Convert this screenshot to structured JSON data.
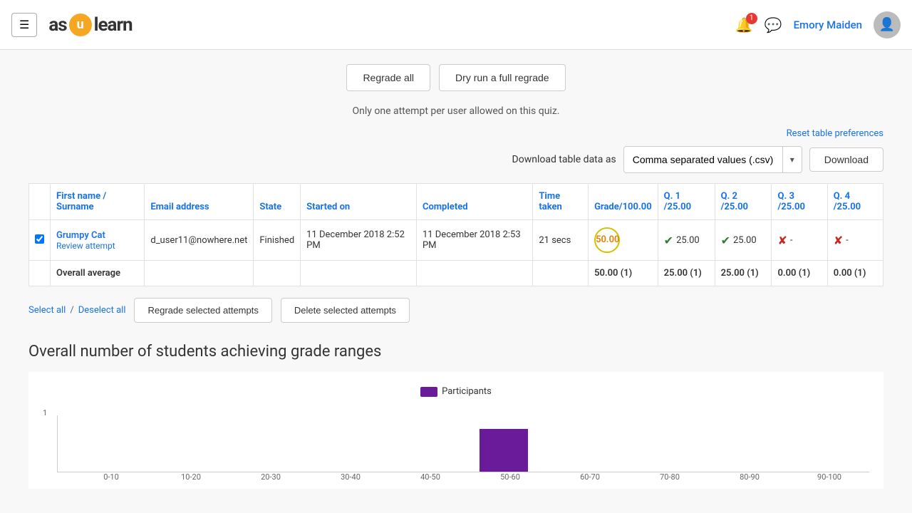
{
  "header": {
    "menu_label": "☰",
    "logo_pre": "as",
    "logo_u": "u",
    "logo_post": "learn",
    "notification_count": "1",
    "user_name": "Emory Maiden",
    "avatar_icon": "👤"
  },
  "top_buttons": {
    "regrade_all": "Regrade all",
    "dry_run": "Dry run a full regrade"
  },
  "info": {
    "text": "Only one attempt per user allowed on this quiz."
  },
  "reset_link": "Reset table preferences",
  "download": {
    "label": "Download table data as",
    "option": "Comma separated values (.csv)",
    "button": "Download"
  },
  "table": {
    "headers": {
      "name": "First name / Surname",
      "email": "Email address",
      "state": "State",
      "started": "Started on",
      "completed": "Completed",
      "time": "Time taken",
      "grade": "Grade/100.00",
      "q1": "Q. 1 /25.00",
      "q2": "Q. 2 /25.00",
      "q3": "Q. 3 /25.00",
      "q4": "Q. 4 /25.00"
    },
    "rows": [
      {
        "checked": true,
        "first_name": "Grumpy Cat",
        "review_text": "Review attempt",
        "email": "d_user11@nowhere.net",
        "state": "Finished",
        "started": "11 December 2018 2:52 PM",
        "completed": "11 December 2018 2:53 PM",
        "time": "21 secs",
        "grade": "50.00",
        "q1_check": "✔",
        "q1_val": "25.00",
        "q2_check": "✔",
        "q2_val": "25.00",
        "q3_check": "✘",
        "q3_val": "-",
        "q4_check": "✘",
        "q4_val": "-"
      }
    ],
    "avg_row": {
      "label": "Overall average",
      "grade": "50.00 (1)",
      "q1": "25.00 (1)",
      "q2": "25.00 (1)",
      "q3": "0.00 (1)",
      "q4": "0.00 (1)"
    }
  },
  "bottom_actions": {
    "select_all": "Select all",
    "deselect_all": "Deselect all",
    "regrade": "Regrade selected attempts",
    "delete": "Delete selected attempts"
  },
  "grade_ranges": {
    "title": "Overall number of students achieving grade ranges",
    "legend_label": "Participants",
    "chart": {
      "y_label": "1",
      "bars": [
        {
          "label": "0-10",
          "height": 0
        },
        {
          "label": "10-20",
          "height": 0
        },
        {
          "label": "20-30",
          "height": 0
        },
        {
          "label": "30-40",
          "height": 0
        },
        {
          "label": "40-50",
          "height": 0
        },
        {
          "label": "50-60",
          "height": 60
        },
        {
          "label": "60-70",
          "height": 0
        },
        {
          "label": "70-80",
          "height": 0
        },
        {
          "label": "80-90",
          "height": 0
        },
        {
          "label": "90-100",
          "height": 0
        }
      ]
    }
  }
}
